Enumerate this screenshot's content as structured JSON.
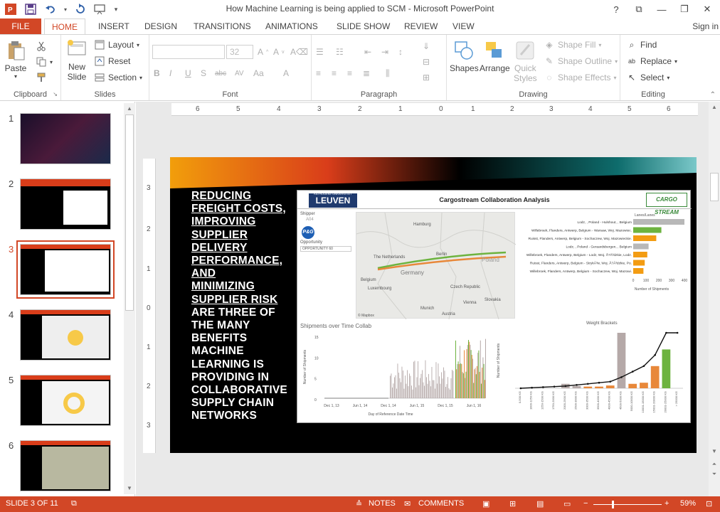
{
  "window": {
    "title": "How Machine Learning is being applied to SCM - Microsoft PowerPoint"
  },
  "quick_access": {
    "icons": [
      "powerpoint-icon",
      "save-icon",
      "undo-icon",
      "redo-icon",
      "start-from-beginning-icon"
    ]
  },
  "window_controls": {
    "help": "?",
    "ribbon_display": "⧉",
    "minimize": "—",
    "restore": "❐",
    "close": "✕"
  },
  "tabs": [
    "FILE",
    "HOME",
    "INSERT",
    "DESIGN",
    "TRANSITIONS",
    "ANIMATIONS",
    "SLIDE SHOW",
    "REVIEW",
    "VIEW"
  ],
  "active_tab": "HOME",
  "signin": "Sign in",
  "ribbon": {
    "clipboard": {
      "label": "Clipboard",
      "paste": "Paste"
    },
    "slides": {
      "label": "Slides",
      "new_slide": "New Slide",
      "new_slide_line1": "New",
      "new_slide_line2": "Slide",
      "layout": "Layout",
      "reset": "Reset",
      "section": "Section"
    },
    "font": {
      "label": "Font",
      "font_name": "",
      "font_size": "32"
    },
    "paragraph": {
      "label": "Paragraph"
    },
    "drawing": {
      "label": "Drawing",
      "shapes": "Shapes",
      "arrange": "Arrange",
      "quick_styles": "Quick Styles",
      "quick_styles_line1": "Quick",
      "quick_styles_line2": "Styles",
      "shape_fill": "Shape Fill",
      "shape_outline": "Shape Outline",
      "shape_effects": "Shape Effects"
    },
    "editing": {
      "label": "Editing",
      "find": "Find",
      "replace": "Replace",
      "select": "Select"
    }
  },
  "slides_panel": {
    "numbers": [
      "1",
      "2",
      "3",
      "4",
      "5",
      "6"
    ],
    "selected": 3
  },
  "ruler": {
    "h_labels": [
      "6",
      "5",
      "4",
      "3",
      "2",
      "1",
      "0",
      "1",
      "2",
      "3",
      "4",
      "5",
      "6"
    ],
    "v_labels": [
      "3",
      "2",
      "1",
      "0",
      "1",
      "2",
      "3"
    ]
  },
  "slide": {
    "underlined_lines": [
      "REDUCING",
      "FREIGHT COSTS,",
      "IMPROVING",
      "SUPPLIER",
      "DELIVERY",
      "PERFORMANCE,",
      "AND",
      "MINIMIZING",
      "SUPPLIER RISK"
    ],
    "plain_lines": [
      "ARE THREE OF",
      "THE MANY",
      "BENEFITS",
      "MACHINE",
      "LEARNING IS",
      "PROVIDING IN",
      "COLLABORATIVE",
      "SUPPLY CHAIN",
      "NETWORKS"
    ],
    "dashboard": {
      "title": "Cargostream Collaboration Analysis",
      "university_top": "KATHOLIEKE UNIVERSITEIT",
      "university": "LEUVEN",
      "logo": "CARGO STREAM",
      "shipper_label": "Shipper",
      "shipper_value": "A04",
      "opportunity_label": "Opportunity",
      "opportunity_value": "OPPORTUNITY 60",
      "map_labels": [
        "Hamburg",
        "The Netherlands",
        "Berlin",
        "Poland",
        "Germany",
        "Belgium",
        "Luxembourg",
        "Czech Republic",
        "Munich",
        "Slovakia",
        "Vienna",
        "Austria"
      ],
      "map_credit": "© Mapbox",
      "lanes_label": "Lanes/Lanes",
      "lanes": [
        "Lodz, , Poland - Hulshout, , Belgium",
        "Willebroek, Flanders, Antwerp, Belgium - Warsaw, Woj. Mazowiec.",
        "Ruisst, Flanders, Antwerp, Belgium - Sochaczew, Woj. Mazowieckie.",
        "Lodz, , Poland - Geraardsbergen, , Belgium",
        "Willebroek, Flanders, Antwerp, Belgium - Lodz, Woj. Å?Ã³dzkie, Lodz.",
        "Ruisst, Flanders, Antwerp, Belgium - StrykÃ³w, Woj. Å?Ã³dzkie, Po.",
        "Willebroek, Flanders, Antwerp, Belgium - Sochaczew, Woj. Mazowi."
      ],
      "lane_values": [
        400,
        220,
        180,
        120,
        110,
        90,
        80
      ],
      "lane_colors": [
        "#b8b8b8",
        "#6db33f",
        "#f39c12",
        "#b8b8b8",
        "#f39c12",
        "#f39c12",
        "#f39c12"
      ],
      "lanes_axis": [
        "0",
        "100",
        "200",
        "300",
        "400"
      ],
      "lanes_xlabel": "Number of Shipments",
      "time_title": "Shipments over Time Collab",
      "time_ylabel": "Number of Shipments",
      "time_xlabel": "Day of Reference Date Time",
      "time_yticks": [
        "15",
        "10",
        "5",
        "0"
      ],
      "time_xticks": [
        "Dec 1, 13",
        "Jun 1, 14",
        "Dec 1, 14",
        "Jun 1, 15",
        "Dec 1, 15",
        "Jun 1, 16"
      ],
      "weight_title": "Weight Brackets",
      "weight_ylabel": "Number of Shipments",
      "weight_categories": [
        "0-500 KG",
        "1000-1250 KG",
        "1250-1500 KG",
        "1750-2000 KG",
        "2000-2500 KG",
        "2500-3000 KG",
        "3000-3500 KG",
        "3500-4000 KG",
        "4000-4500 KG",
        "4500-5000 KG",
        "5000-10000 KG",
        "10001-15000 KG",
        "15001-20000 KG",
        "20001-25000 KG",
        "> 25000 KG"
      ]
    }
  },
  "status": {
    "slide_info": "SLIDE 3 OF 11",
    "notes": "NOTES",
    "comments": "COMMENTS",
    "zoom": "59%"
  }
}
